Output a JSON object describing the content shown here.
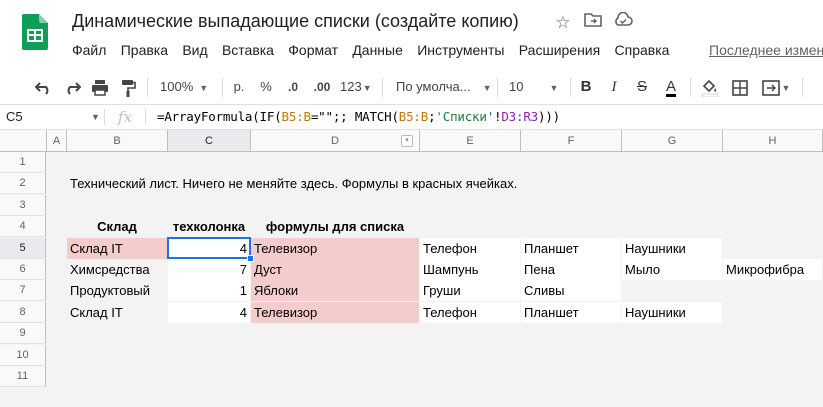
{
  "app": {
    "doc_title": "Динамические выпадающие списки (создайте копию)",
    "last_edit": "Последнее измен",
    "menu": [
      "Файл",
      "Правка",
      "Вид",
      "Вставка",
      "Формат",
      "Данные",
      "Инструменты",
      "Расширения",
      "Справка"
    ]
  },
  "toolbar": {
    "zoom": "100%",
    "currency": "р.",
    "percent": "%",
    "dec_decrease": ".0",
    "dec_increase": ".00",
    "format_more": "123",
    "font": "По умолча...",
    "font_size": "10",
    "bold": "B",
    "italic": "I",
    "strike": "S",
    "text_color": "A"
  },
  "formula_bar": {
    "cell_ref": "C5",
    "fx": "fx",
    "formula_parts": [
      {
        "text": "=ArrayFormula(IF(",
        "color": "plain"
      },
      {
        "text": "B5:B",
        "color": "orange"
      },
      {
        "text": "=\"\";; MATCH(",
        "color": "plain"
      },
      {
        "text": "B5:B",
        "color": "orange"
      },
      {
        "text": ";",
        "color": "plain"
      },
      {
        "text": "'Списки'",
        "color": "green"
      },
      {
        "text": "!",
        "color": "plain"
      },
      {
        "text": "D3:R3",
        "color": "purple"
      },
      {
        "text": ")))",
        "color": "plain"
      }
    ]
  },
  "columns": [
    "A",
    "B",
    "C",
    "D",
    "E",
    "F",
    "G",
    "H"
  ],
  "rows": [
    "1",
    "2",
    "3",
    "4",
    "5",
    "6",
    "7",
    "8",
    "9",
    "10",
    "11"
  ],
  "sheet": {
    "note": "Технический лист. Ничего не меняйте здесь. Формулы в красных ячейках.",
    "headers": [
      "Склад",
      "техколонка",
      "формулы для списка"
    ],
    "data_rows": [
      {
        "b": "Склад IT",
        "c": "4",
        "d": "Телевизор",
        "e": "Телефон",
        "f": "Планшет",
        "g": "Наушники",
        "h": ""
      },
      {
        "b": "Химсредства",
        "c": "7",
        "d": "Дуст",
        "e": "Шампунь",
        "f": "Пена",
        "g": "Мыло",
        "h": "Микрофибра"
      },
      {
        "b": "Продуктовый",
        "c": "1",
        "d": "Яблоки",
        "e": "Груши",
        "f": "Сливы",
        "g": "",
        "h": ""
      },
      {
        "b": "Склад IT",
        "c": "4",
        "d": "Телевизор",
        "e": "Телефон",
        "f": "Планшет",
        "g": "Наушники",
        "h": ""
      }
    ]
  },
  "colors": {
    "pink_fill": "#f4cccc",
    "selection": "#1a73e8",
    "logo_green": "#0f9d58"
  },
  "icons": [
    "sheets-logo-icon",
    "star-icon",
    "move-to-folder-icon",
    "cloud-saved-icon",
    "undo-icon",
    "redo-icon",
    "print-icon",
    "paint-format-icon",
    "fill-color-icon",
    "borders-icon",
    "merge-cells-icon",
    "filter-icon"
  ]
}
